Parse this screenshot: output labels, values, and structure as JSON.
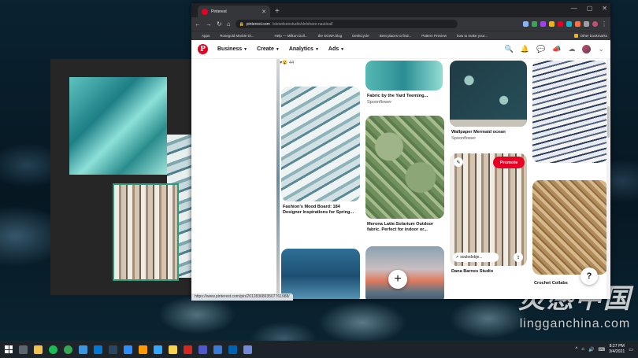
{
  "watermark": {
    "logo": "灵感中国",
    "url": "lingganchina.com"
  },
  "browser": {
    "tab_title": "Pinterest",
    "new_tab": "+",
    "window_controls": [
      "—",
      "▢",
      "✕"
    ],
    "url_host": "pinterest.com",
    "url_path": "/stewdsonstudio/delshare-nautical/",
    "bookmarks": [
      {
        "label": "Apps",
        "color": "#8ab4f8"
      },
      {
        "label": "Rosegold Marble Di...",
        "color": "#e07b39"
      },
      {
        "label": "",
        "color": "#4285f4"
      },
      {
        "label": "Help — Milkon Doll...",
        "color": "#ffffff"
      },
      {
        "label": "the SGWA blog",
        "color": "#cccccc"
      },
      {
        "label": "DeskCycle",
        "color": "#888888"
      },
      {
        "label": "Best places to find...",
        "color": "#111111"
      },
      {
        "label": "Pattern Preview",
        "color": "#e60023"
      },
      {
        "label": "how to make your...",
        "color": "#3aa0ff"
      }
    ],
    "other_bookmarks": "Other bookmarks",
    "status_url": "https://www.pinterest.com/pin/2012836893507761988/"
  },
  "pinterest": {
    "logo": "P",
    "nav": [
      {
        "label": "Business"
      },
      {
        "label": "Create"
      },
      {
        "label": "Analytics"
      },
      {
        "label": "Ads"
      }
    ],
    "reactions": "♥😮 44",
    "pins": {
      "c1a_title": "Fashion's Mood Board: 184 Designer Inspirations for Spring...",
      "c2a_title": "Fabric by the Yard Teeming...",
      "c2a_source": "Spoonflower",
      "c2b_title": "Merona Latte:Solarium Outdoor fabric. Perfect for indoor or...",
      "c3a_title": "Wallpaper Mermaid ocean",
      "c3a_source": "Spoonflower",
      "c3b_promote": "Promote",
      "c3b_source_link": "souledobje...",
      "c3b_title": "Dana Barnes Studio",
      "c4b_title": "Crochet Collabs"
    },
    "plus": "+",
    "help": "?"
  },
  "taskbar": {
    "apps": [
      {
        "name": "search",
        "color": "#ffffff"
      },
      {
        "name": "file-explorer",
        "color": "#f2c14e"
      },
      {
        "name": "spotify",
        "color": "#1db954"
      },
      {
        "name": "chrome",
        "color": "#34a853"
      },
      {
        "name": "store",
        "color": "#3a96dd"
      },
      {
        "name": "mail",
        "color": "#0078d4"
      },
      {
        "name": "steam",
        "color": "#2a475e"
      },
      {
        "name": "zoom",
        "color": "#2d8cff"
      },
      {
        "name": "illustrator",
        "color": "#ff9a00"
      },
      {
        "name": "photoshop",
        "color": "#31a8ff"
      },
      {
        "name": "sticky-notes",
        "color": "#f7d44c"
      },
      {
        "name": "acrobat",
        "color": "#d7261e"
      },
      {
        "name": "teams",
        "color": "#5059c9"
      },
      {
        "name": "calendar",
        "color": "#3a7bd5"
      },
      {
        "name": "photos",
        "color": "#0063b1"
      },
      {
        "name": "discord",
        "color": "#7289da"
      }
    ],
    "time": "8:27 PM",
    "date": "3/4/2021"
  }
}
